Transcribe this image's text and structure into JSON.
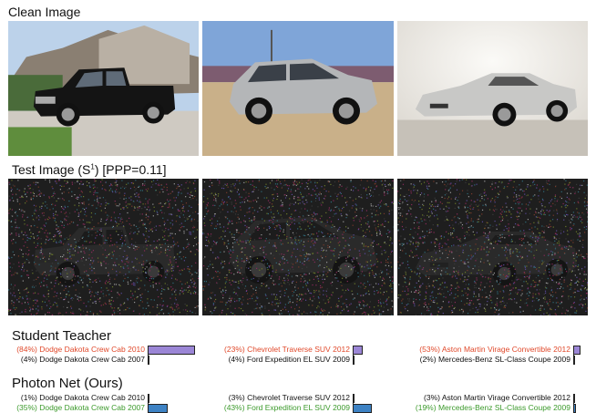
{
  "headings": {
    "clean": "Clean Image",
    "test_prefix": "Test Image (S",
    "test_sup": "1",
    "test_suffix": ") [PPP=0.11]",
    "student": "Student Teacher",
    "photon": "Photon Net (Ours)"
  },
  "images": {
    "clean": [
      {
        "label": "black pickup truck in driveway",
        "type": "truck",
        "sky": "#bcd2ea",
        "ground": "#cfcac2",
        "car": "#141414"
      },
      {
        "label": "silver SUV in parking lot",
        "type": "suv",
        "sky": "#7fa5d8",
        "ground": "#c9b089",
        "car": "#b4b6b8"
      },
      {
        "label": "silver convertible sports car in studio",
        "type": "sport",
        "sky": "#ddd9d2",
        "ground": "#c6c1b8",
        "car": "#c8c8c6"
      }
    ],
    "noisy": [
      {
        "label": "noisy low-light pickup truck",
        "type": "truck"
      },
      {
        "label": "noisy low-light SUV",
        "type": "suv"
      },
      {
        "label": "noisy low-light sports car",
        "type": "sport"
      }
    ]
  },
  "colors": {
    "correct": "#3c9a2c",
    "wrong": "#e0492b",
    "neutral": "#111111",
    "student_bar": "#9b86d6",
    "photon_bar": "#3d82c4"
  },
  "student_teacher": [
    {
      "top": {
        "pct": "(84%)",
        "label": "Dodge Dakota Crew Cab 2010",
        "status": "wrong",
        "value": 0.84
      },
      "second": {
        "pct": "(4%)",
        "label": "Dodge Dakota Crew Cab 2007",
        "status": "neutral",
        "value": 0.04
      }
    },
    {
      "top": {
        "pct": "(23%)",
        "label": "Chevrolet Traverse SUV 2012",
        "status": "wrong",
        "value": 0.23
      },
      "second": {
        "pct": "(4%)",
        "label": "Ford Expedition EL SUV 2009",
        "status": "neutral",
        "value": 0.04
      }
    },
    {
      "top": {
        "pct": "(53%)",
        "label": "Aston Martin Virage Convertible 2012",
        "status": "wrong",
        "value": 0.53
      },
      "second": {
        "pct": "(2%)",
        "label": "Mercedes-Benz SL-Class Coupe 2009",
        "status": "neutral",
        "value": 0.02
      }
    }
  ],
  "photon_net": [
    {
      "top": {
        "pct": "(1%)",
        "label": "Dodge Dakota Crew Cab 2010",
        "status": "neutral",
        "value": 0.01
      },
      "second": {
        "pct": "(35%)",
        "label": "Dodge Dakota Crew Cab 2007",
        "status": "correct",
        "value": 0.35
      }
    },
    {
      "top": {
        "pct": "(3%)",
        "label": "Chevrolet Traverse SUV 2012",
        "status": "neutral",
        "value": 0.03
      },
      "second": {
        "pct": "(43%)",
        "label": "Ford Expedition EL SUV 2009",
        "status": "correct",
        "value": 0.43
      }
    },
    {
      "top": {
        "pct": "(3%)",
        "label": "Aston Martin Virage Convertible 2012",
        "status": "neutral",
        "value": 0.03
      },
      "second": {
        "pct": "(19%)",
        "label": "Mercedes-Benz SL-Class Coupe 2009",
        "status": "correct",
        "value": 0.19
      }
    }
  ]
}
